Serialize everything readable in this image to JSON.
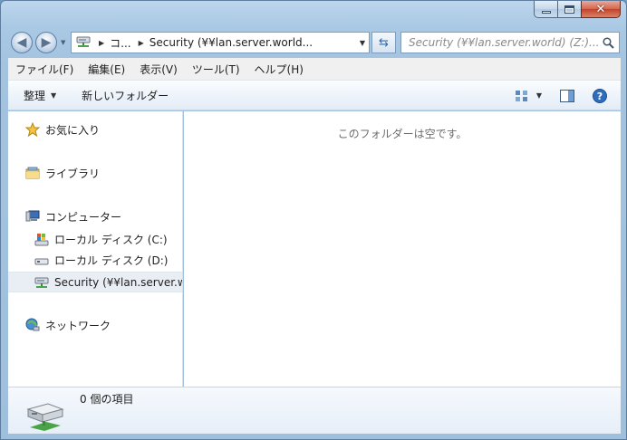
{
  "address": {
    "crumbs": [
      "コ...",
      "Security (¥¥lan.server.world..."
    ]
  },
  "search": {
    "placeholder": "Security (¥¥lan.server.world) (Z:)..."
  },
  "menu": [
    {
      "label": "ファイル(F)"
    },
    {
      "label": "編集(E)"
    },
    {
      "label": "表示(V)"
    },
    {
      "label": "ツール(T)"
    },
    {
      "label": "ヘルプ(H)"
    }
  ],
  "toolbar": {
    "organize_label": "整理",
    "new_folder_label": "新しいフォルダー"
  },
  "nav": {
    "favorites": "お気に入り",
    "libraries": "ライブラリ",
    "computer": "コンピューター",
    "drive_c": "ローカル ディスク (C:)",
    "drive_d": "ローカル ディスク (D:)",
    "network_drive": "Security (¥¥lan.server.w",
    "network": "ネットワーク"
  },
  "content": {
    "empty_message": "このフォルダーは空です。"
  },
  "details": {
    "item_count": "0 個の項目"
  },
  "colors": {
    "frame": "#a9c8e4",
    "selection": "#e9eef4",
    "close_button": "#c2442a"
  }
}
